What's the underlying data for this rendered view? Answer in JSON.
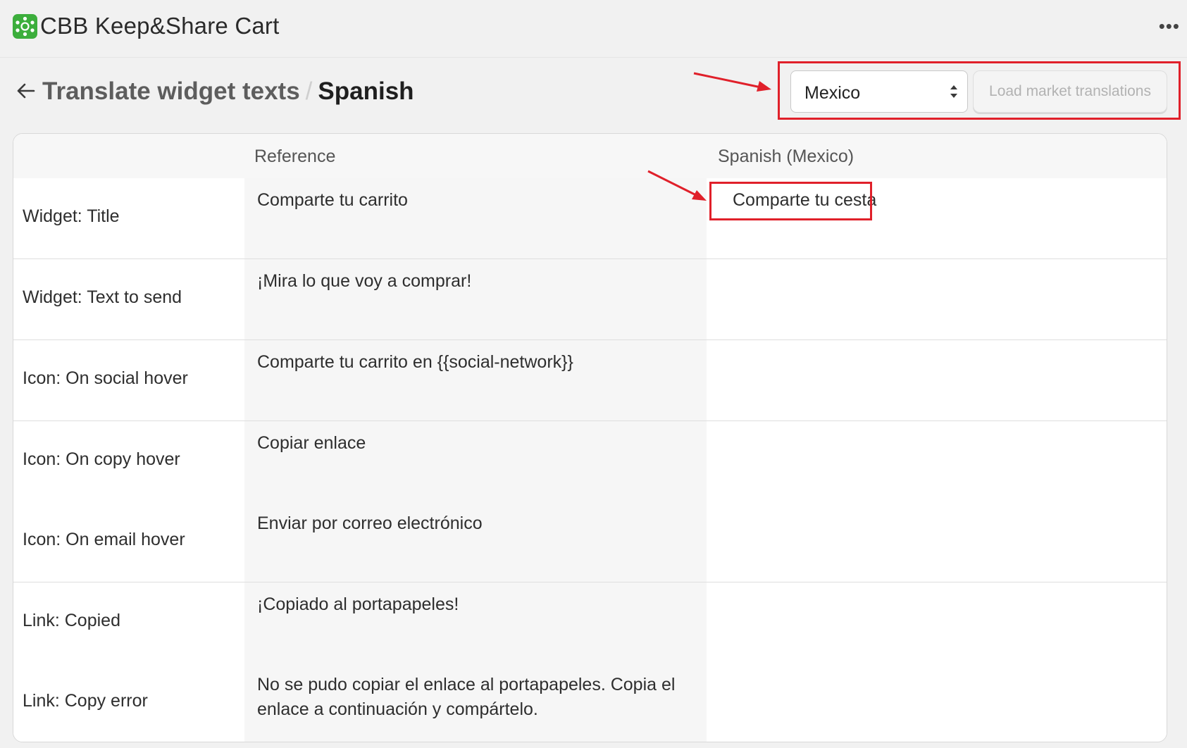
{
  "app": {
    "title": "CBB Keep&Share Cart"
  },
  "page": {
    "breadcrumb_parent": "Translate widget texts",
    "breadcrumb_separator": "/",
    "breadcrumb_current": "Spanish"
  },
  "market_select": {
    "value": "Mexico"
  },
  "load_button": {
    "label": "Load market translations"
  },
  "table": {
    "headers": [
      "",
      "Reference",
      "Spanish (Mexico)"
    ],
    "rows": [
      {
        "key": "Widget: Title",
        "reference": "Comparte tu carrito",
        "translation": "Comparte tu cesta"
      },
      {
        "key": "Widget: Text to send",
        "reference": "¡Mira lo que voy a comprar!",
        "translation": ""
      },
      {
        "key": "Icon: On social hover",
        "reference": "Comparte tu carrito en {{social-network}}",
        "translation": ""
      },
      {
        "key": "Icon: On copy hover",
        "reference": "Copiar enlace",
        "translation": ""
      },
      {
        "key": "Icon: On email hover",
        "reference": "Enviar por correo electrónico",
        "translation": ""
      },
      {
        "key": "Link: Copied",
        "reference": "¡Copiado al portapapeles!",
        "translation": ""
      },
      {
        "key": "Link: Copy error",
        "reference": "No se pudo copiar el enlace al portapapeles. Copia el enlace a continuación y compártelo.",
        "translation": ""
      }
    ]
  },
  "colors": {
    "annotation": "#e0202a",
    "logo": "#3cae3c"
  },
  "icons": {
    "back": "arrow-left-icon",
    "more": "more-horizontal-icon",
    "select": "select-arrows-icon",
    "logo": "app-logo-icon"
  }
}
